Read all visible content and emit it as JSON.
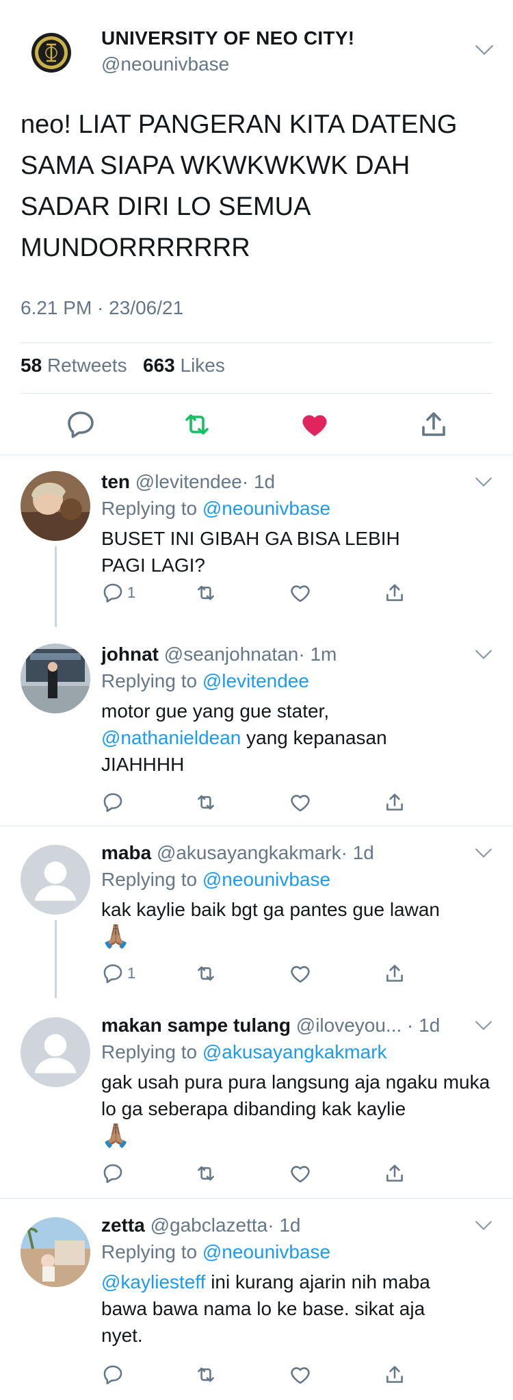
{
  "main_tweet": {
    "name": "UNIVERSITY OF NEO CITY!",
    "handle": "@neounivbase",
    "text": "neo! LIAT PANGERAN KITA DATENG\nSAMA SIAPA WKWKWKWK DAH\nSADAR DIRI LO SEMUA\nMUNDORRRRRRR",
    "timestamp": "6.21 PM · 23/06/21",
    "retweets_count": "58",
    "retweets_label": "Retweets",
    "likes_count": "663",
    "likes_label": "Likes",
    "liked": true,
    "icons": [
      "reply-icon",
      "retweet-icon",
      "like-icon",
      "share-icon"
    ],
    "colors": {
      "retweet": "#17bf63",
      "like": "#e0245e",
      "icon": "#657786"
    }
  },
  "replies": [
    {
      "name": "ten",
      "handle": "@levitendee",
      "time": "· 1d",
      "replying_prefix": "Replying to",
      "replying_to": "@neounivbase",
      "text": "BUSET INI GIBAH GA BISA LEBIH PAGI LAGI?",
      "reply_count": "1"
    },
    {
      "name": "johnat",
      "handle": "@seanjohnatan",
      "time": "· 1m",
      "replying_prefix": "Replying to",
      "replying_to": "@levitendee",
      "text_mention": "@nathanieldean",
      "text_before": "motor gue yang gue stater,",
      "text_after": " yang kepanasan JIAHHHH",
      "reply_count": ""
    },
    {
      "name": "maba",
      "handle": "@akusayangkakmark",
      "time": "· 1d",
      "replying_prefix": "Replying to",
      "replying_to": "@neounivbase",
      "text": "kak kaylie baik bgt ga pantes gue lawan",
      "emoji": "🙏🏽",
      "reply_count": "1"
    },
    {
      "name": "makan sampe tulang",
      "handle": "@iloveyou...",
      "time": "· 1d",
      "replying_prefix": "Replying to",
      "replying_to": "@akusayangkakmark",
      "text": "gak usah pura pura langsung aja ngaku muka lo ga seberapa dibanding kak kaylie",
      "emoji": "🙏🏽",
      "reply_count": ""
    },
    {
      "name": "zetta",
      "handle": "@gabclazetta",
      "time": "· 1d",
      "replying_prefix": "Replying to",
      "replying_to": "@neounivbase",
      "text_mention": "@kayliesteff",
      "text_after": " ini kurang ajarin nih maba bawa bawa nama lo ke base. sikat aja nyet.",
      "reply_count": ""
    }
  ]
}
